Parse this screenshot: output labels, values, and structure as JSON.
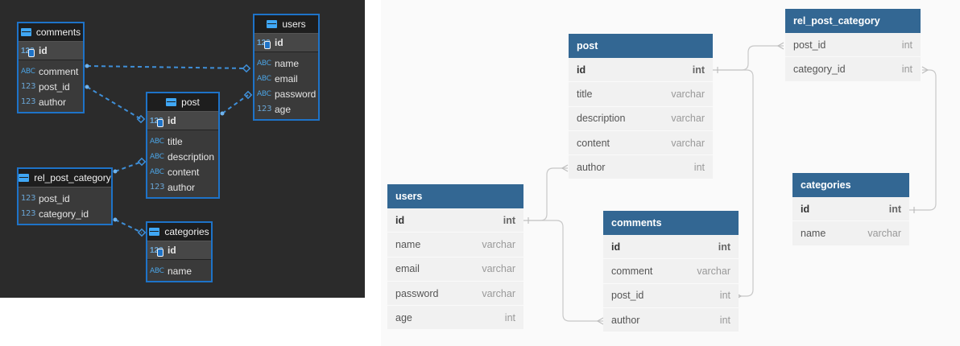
{
  "dark_diagram": {
    "tables": {
      "comments": {
        "name": "comments",
        "pk": "id",
        "pk_type": "123",
        "columns": [
          {
            "type": "ABC",
            "name": "comment"
          },
          {
            "type": "123",
            "name": "post_id"
          },
          {
            "type": "123",
            "name": "author"
          }
        ]
      },
      "users": {
        "name": "users",
        "pk": "id",
        "pk_type": "123",
        "columns": [
          {
            "type": "ABC",
            "name": "name"
          },
          {
            "type": "ABC",
            "name": "email"
          },
          {
            "type": "ABC",
            "name": "password"
          },
          {
            "type": "123",
            "name": "age"
          }
        ]
      },
      "post": {
        "name": "post",
        "pk": "id",
        "pk_type": "123",
        "columns": [
          {
            "type": "ABC",
            "name": "title"
          },
          {
            "type": "ABC",
            "name": "description"
          },
          {
            "type": "ABC",
            "name": "content"
          },
          {
            "type": "123",
            "name": "author"
          }
        ]
      },
      "rel_post_category": {
        "name": "rel_post_category",
        "columns": [
          {
            "type": "123",
            "name": "post_id"
          },
          {
            "type": "123",
            "name": "category_id"
          }
        ]
      },
      "categories": {
        "name": "categories",
        "pk": "id",
        "pk_type": "123",
        "columns": [
          {
            "type": "ABC",
            "name": "name"
          }
        ]
      }
    },
    "relationships": [
      {
        "from": "comments.id",
        "to": "users.name"
      },
      {
        "from": "comments.post_id",
        "to": "post.id"
      },
      {
        "from": "post.id",
        "to": "users.password"
      },
      {
        "from": "rel_post_category",
        "to": "post.content"
      },
      {
        "from": "rel_post_category.category_id",
        "to": "categories.id"
      }
    ]
  },
  "light_diagram": {
    "tables": {
      "post": {
        "name": "post",
        "rows": [
          {
            "name": "id",
            "type": "int",
            "pk": true
          },
          {
            "name": "title",
            "type": "varchar"
          },
          {
            "name": "description",
            "type": "varchar"
          },
          {
            "name": "content",
            "type": "varchar"
          },
          {
            "name": "author",
            "type": "int"
          }
        ]
      },
      "rel_post_category": {
        "name": "rel_post_category",
        "rows": [
          {
            "name": "post_id",
            "type": "int"
          },
          {
            "name": "category_id",
            "type": "int"
          }
        ]
      },
      "users": {
        "name": "users",
        "rows": [
          {
            "name": "id",
            "type": "int",
            "pk": true
          },
          {
            "name": "name",
            "type": "varchar"
          },
          {
            "name": "email",
            "type": "varchar"
          },
          {
            "name": "password",
            "type": "varchar"
          },
          {
            "name": "age",
            "type": "int"
          }
        ]
      },
      "comments": {
        "name": "comments",
        "rows": [
          {
            "name": "id",
            "type": "int",
            "pk": true
          },
          {
            "name": "comment",
            "type": "varchar"
          },
          {
            "name": "post_id",
            "type": "int"
          },
          {
            "name": "author",
            "type": "int"
          }
        ]
      },
      "categories": {
        "name": "categories",
        "rows": [
          {
            "name": "id",
            "type": "int",
            "pk": true
          },
          {
            "name": "name",
            "type": "varchar"
          }
        ]
      }
    },
    "relationships": [
      {
        "from": "post.id",
        "to": "rel_post_category.post_id"
      },
      {
        "from": "post.id",
        "to": "comments.post_id"
      },
      {
        "from": "users.id",
        "to": "post.author"
      },
      {
        "from": "users.id",
        "to": "comments.author"
      },
      {
        "from": "categories.id",
        "to": "rel_post_category.category_id"
      }
    ]
  },
  "colors": {
    "dark_bg": "#2b2b2b",
    "dark_accent": "#1e73c8",
    "dark_type": "#4ba3e3",
    "light_header": "#336793",
    "light_row": "#f1f1f1",
    "edge_gray": "#c8c8c8"
  }
}
